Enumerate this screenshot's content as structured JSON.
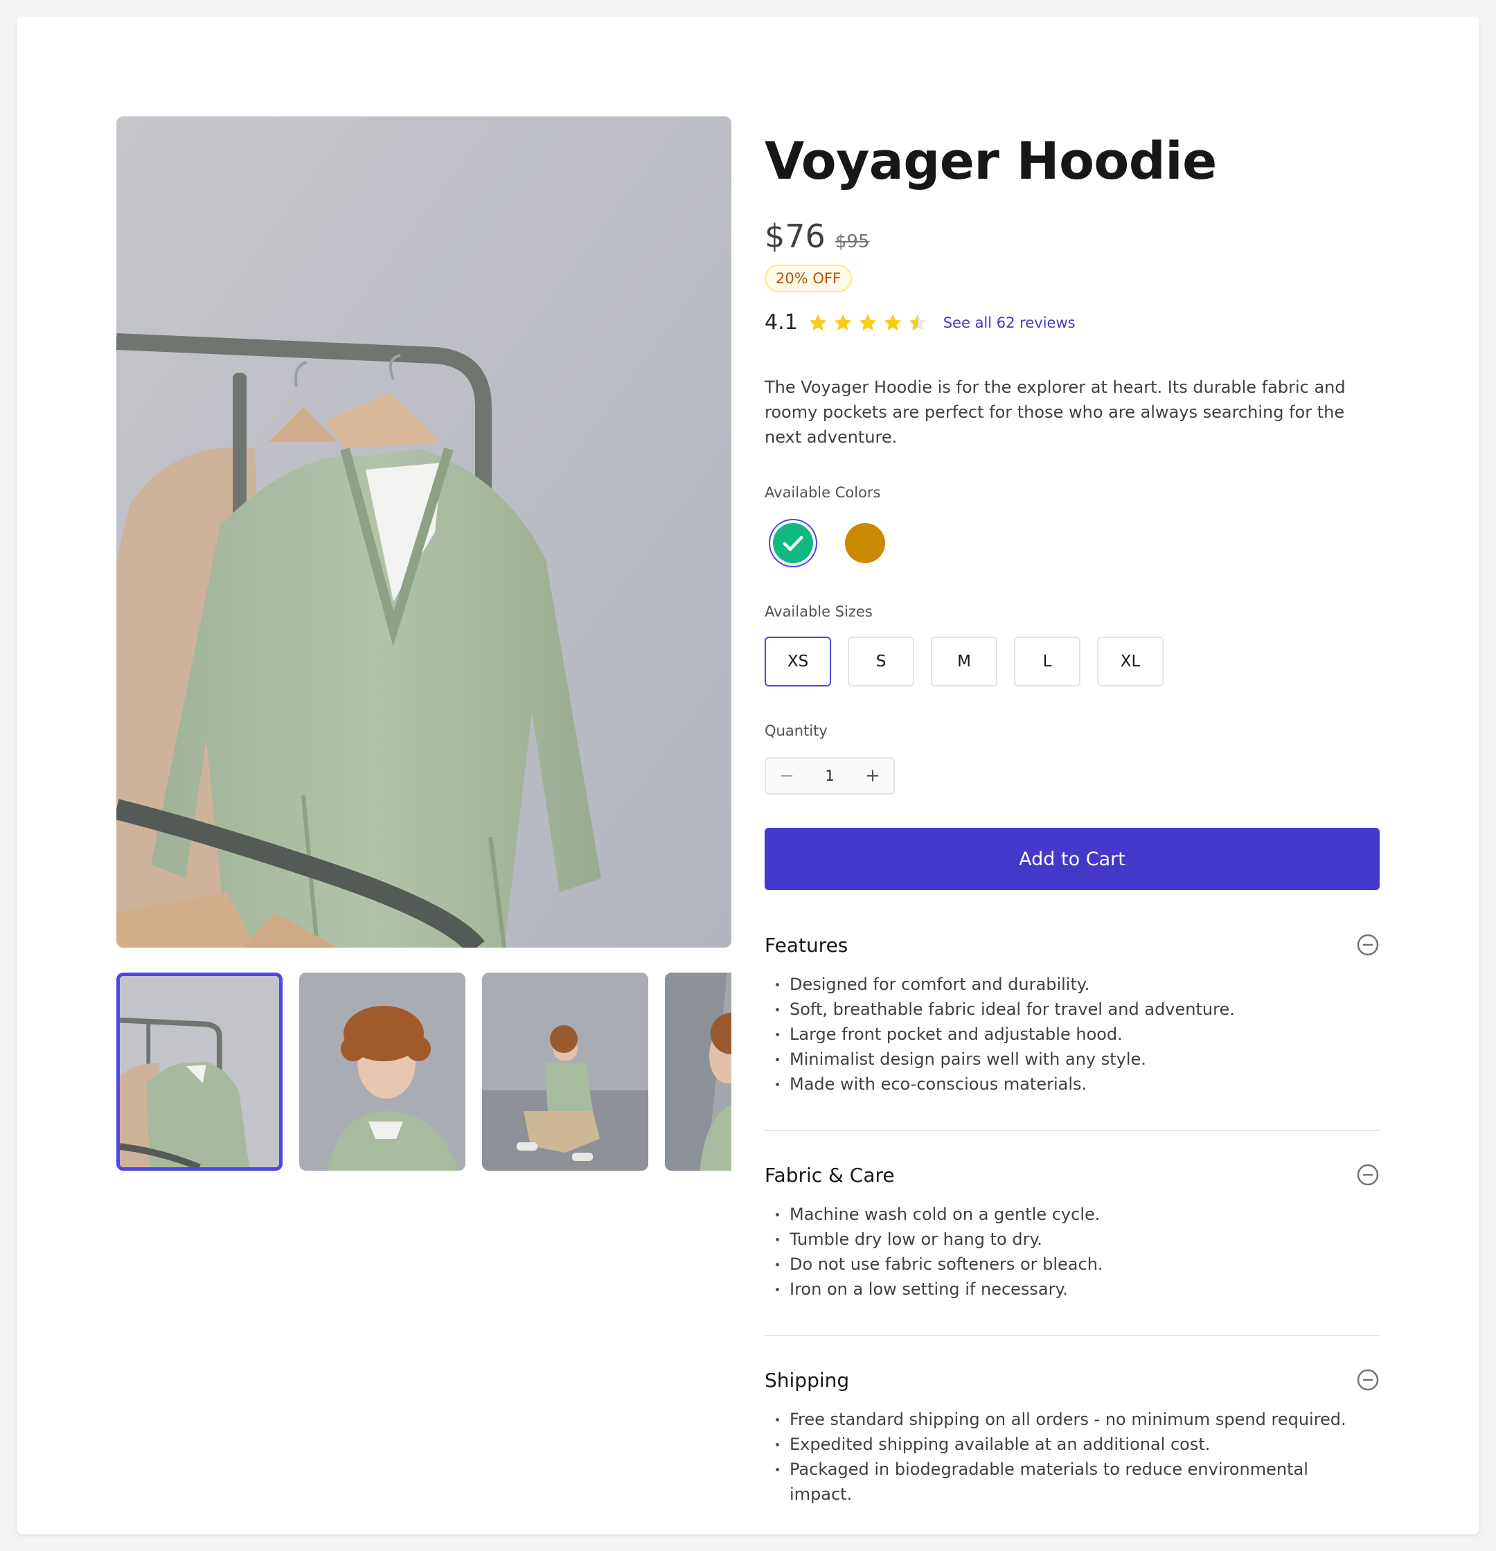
{
  "product": {
    "title": "Voyager Hoodie",
    "price": "$76",
    "original_price": "$95",
    "discount_badge": "20% OFF",
    "rating": "4.1",
    "rating_value": 4.1,
    "rating_max": 5,
    "reviews_link": "See all 62 reviews",
    "description": "The Voyager Hoodie is for the explorer at heart. Its durable fabric and roomy pockets are perfect for those who are always searching for the next adventure."
  },
  "colors": {
    "label": "Available Colors",
    "options": [
      {
        "name": "green",
        "hex": "#10b981",
        "selected": true
      },
      {
        "name": "amber",
        "hex": "#ca8a04",
        "selected": false
      }
    ],
    "selected_ring": "#4f46e5"
  },
  "sizes": {
    "label": "Available Sizes",
    "options": [
      "XS",
      "S",
      "M",
      "L",
      "XL"
    ],
    "selected": "XS"
  },
  "quantity": {
    "label": "Quantity",
    "value": "1",
    "minus_icon": "minus-icon",
    "plus_icon": "plus-icon"
  },
  "cart": {
    "button_label": "Add to Cart",
    "color": "#4338ca"
  },
  "sections": [
    {
      "title": "Features",
      "icon": "collapse-circle-icon",
      "items": [
        "Designed for comfort and durability.",
        "Soft, breathable fabric ideal for travel and adventure.",
        "Large front pocket and adjustable hood.",
        "Minimalist design pairs well with any style.",
        "Made with eco-conscious materials."
      ]
    },
    {
      "title": "Fabric & Care",
      "icon": "collapse-circle-icon",
      "items": [
        "Machine wash cold on a gentle cycle.",
        "Tumble dry low or hang to dry.",
        "Do not use fabric softeners or bleach.",
        "Iron on a low setting if necessary."
      ]
    },
    {
      "title": "Shipping",
      "icon": "collapse-circle-icon",
      "items": [
        "Free standard shipping on all orders - no minimum spend required.",
        "Expedited shipping available at an additional cost.",
        "Packaged in biodegradable materials to reduce environmental impact."
      ]
    }
  ],
  "gallery": {
    "thumbnails": [
      "hoodie-on-rack",
      "model-portrait",
      "model-seated",
      "model-profile"
    ],
    "selected_thumbnail": 0,
    "accent": "#4f46e5"
  }
}
